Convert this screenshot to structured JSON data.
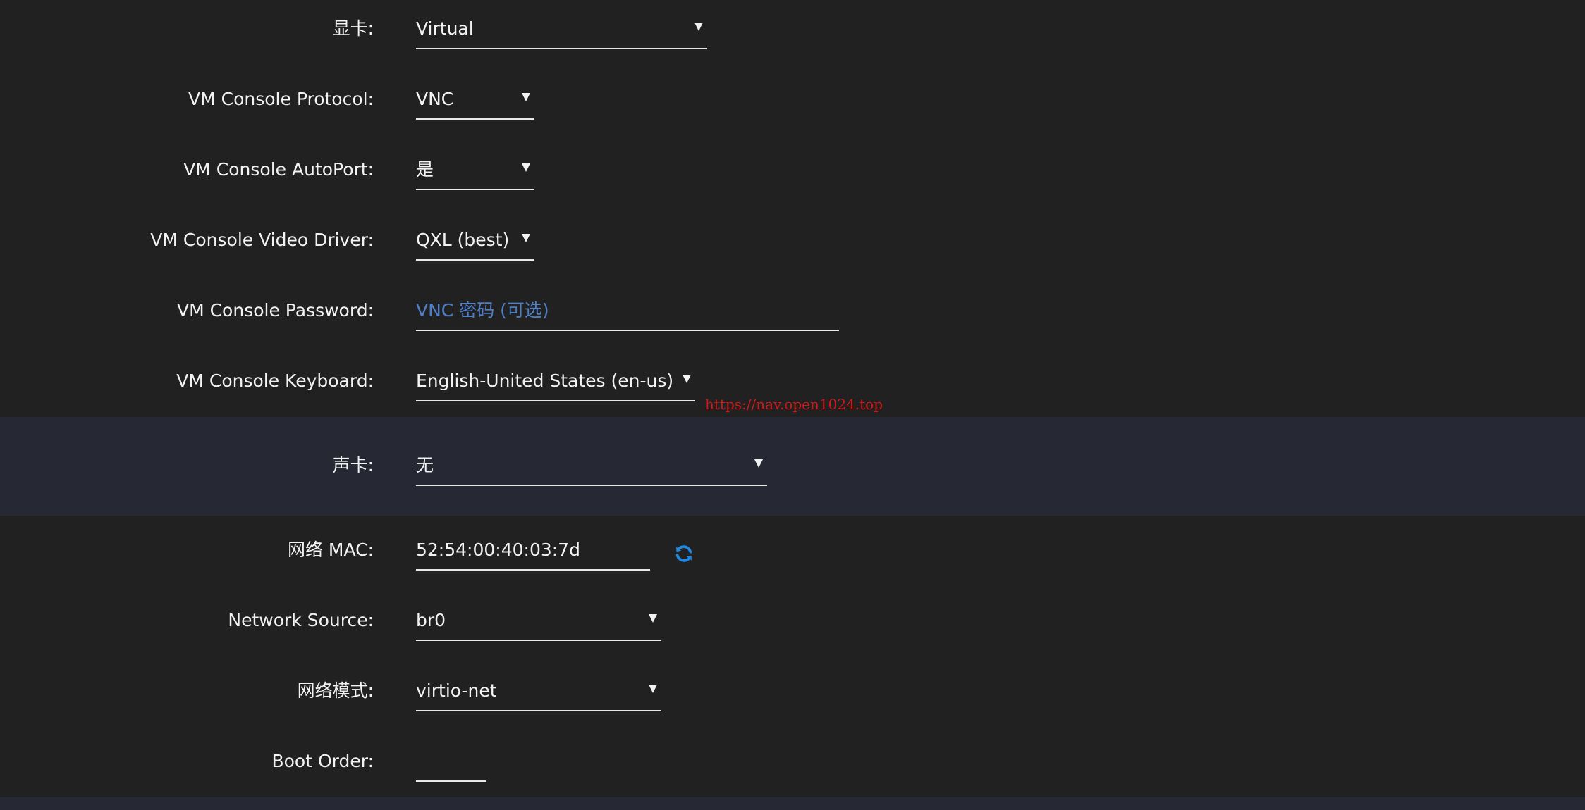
{
  "rows": {
    "graphics": {
      "label": "显卡:",
      "value": "Virtual"
    },
    "console_protocol": {
      "label": "VM Console Protocol:",
      "value": "VNC"
    },
    "console_autoport": {
      "label": "VM Console AutoPort:",
      "value": "是"
    },
    "console_video_driver": {
      "label": "VM Console Video Driver:",
      "value": "QXL (best)"
    },
    "console_password": {
      "label": "VM Console Password:",
      "value": "",
      "placeholder": "VNC 密码 (可选)"
    },
    "console_keyboard": {
      "label": "VM Console Keyboard:",
      "value": "English-United States (en-us)"
    },
    "sound_card": {
      "label": "声卡:",
      "value": "无"
    },
    "network_mac": {
      "label": "网络 MAC:",
      "value": "52:54:00:40:03:7d"
    },
    "network_source": {
      "label": "Network Source:",
      "value": "br0"
    },
    "network_model": {
      "label": "网络模式:",
      "value": "virtio-net"
    },
    "boot_order": {
      "label": "Boot Order:",
      "value": ""
    }
  },
  "icons": {
    "refresh": "refresh-icon"
  },
  "watermark": "https://nav.open1024.top",
  "colors": {
    "background": "#212121",
    "band": "#262834",
    "text": "#f2f2f2",
    "placeholder": "#4f7fc8",
    "refresh_icon": "#1e88e5",
    "watermark": "#d01818"
  }
}
